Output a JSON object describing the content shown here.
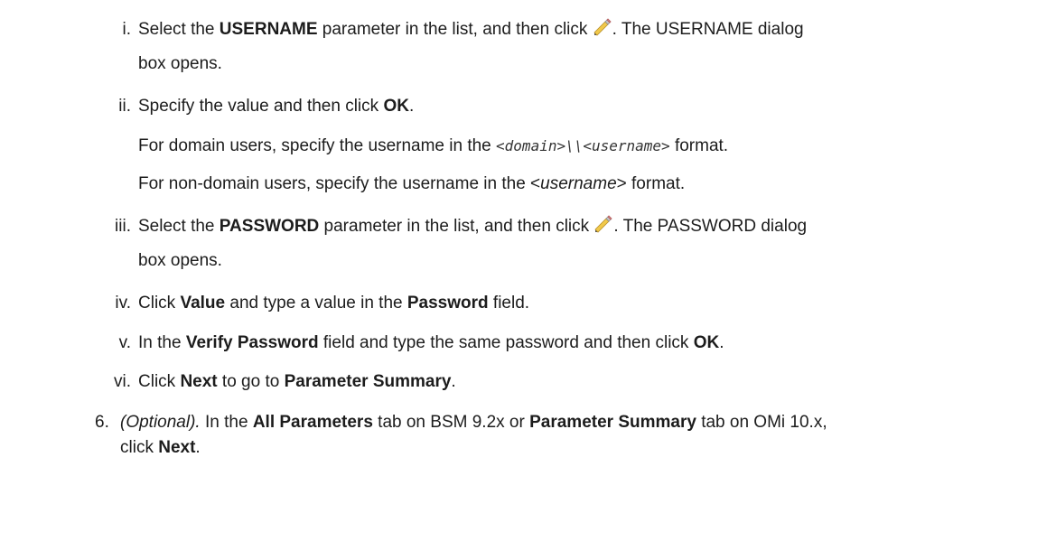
{
  "steps": [
    {
      "marker": "i.",
      "pre": "Select the ",
      "bold1": "USERNAME",
      "mid": " parameter in the list, and then click ",
      "icon": "pencil-edit-icon",
      "post": ". The USERNAME dialog",
      "cont": "box opens."
    },
    {
      "marker": "ii.",
      "pre": "Specify the value and then click ",
      "bold1": "OK",
      "post": ".",
      "note1_pre": "For domain users, specify the username in the ",
      "note1_code": "<domain>\\\\<username>",
      "note1_post": " format.",
      "note2_pre": "For non-domain users, specify the username in the <",
      "note2_em": "username",
      "note2_post": "> format."
    },
    {
      "marker": "iii.",
      "pre": "Select the ",
      "bold1": "PASSWORD",
      "mid": " parameter in the list, and then click ",
      "icon": "pencil-edit-icon",
      "post": ". The PASSWORD dialog",
      "cont": "box opens."
    },
    {
      "marker": "iv.",
      "pre": "Click ",
      "bold1": "Value",
      "mid": " and type a value in the ",
      "bold2": "Password",
      "post": " field."
    },
    {
      "marker": "v.",
      "pre": "In the ",
      "bold1": "Verify Password",
      "mid": " field and type the same password and then click ",
      "bold2": "OK",
      "post": "."
    },
    {
      "marker": "vi.",
      "pre": "Click ",
      "bold1": "Next",
      "mid": " to go to ",
      "bold2": "Parameter Summary",
      "post": "."
    }
  ],
  "step6": {
    "marker": "6.",
    "em": "(Optional).",
    "pre": " In the ",
    "bold1": "All Parameters",
    "mid1": " tab on BSM 9.2x or ",
    "bold2": "Parameter Summary",
    "mid2": " tab on OMi 10.x,",
    "cont_pre": "click ",
    "bold3": "Next",
    "cont_post": "."
  }
}
